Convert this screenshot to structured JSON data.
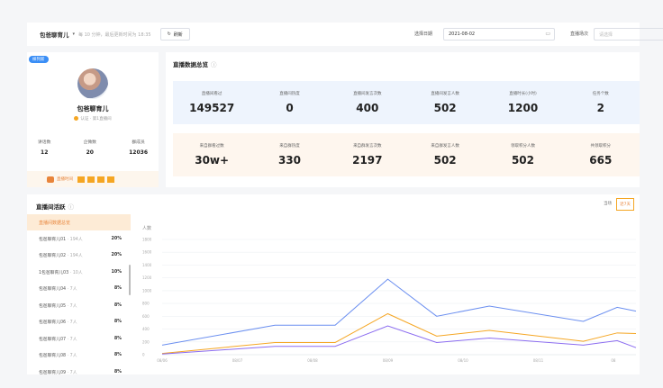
{
  "topbar": {
    "brand": "包爸聊育儿",
    "hint": "每 10 分钟，最后更新时间为 18:35",
    "refresh_label": "刷新",
    "date_label": "选择日期",
    "date_value": "2021-08-02",
    "scene_label": "直播场次",
    "scene_placeholder": "请选择"
  },
  "profile": {
    "tag": "样列新",
    "name": "包爸聊育儿",
    "meta": "认证 · 第1直播间",
    "stats": [
      {
        "label": "讲话数",
        "value": "12"
      },
      {
        "label": "企微数",
        "value": "20"
      },
      {
        "label": "群成员",
        "value": "12036"
      }
    ],
    "live_label": "直播时间"
  },
  "overview": {
    "title": "直播数据总览",
    "row1": [
      {
        "label": "直播间看过",
        "value": "149527"
      },
      {
        "label": "直播间热度",
        "value": "0"
      },
      {
        "label": "直播间发言次数",
        "value": "400"
      },
      {
        "label": "直播间发言人数",
        "value": "502"
      },
      {
        "label": "直播时长(小时)",
        "value": "1200"
      },
      {
        "label": "任务个数",
        "value": "2"
      }
    ],
    "row2": [
      {
        "label": "来自群看过数",
        "value": "30w+"
      },
      {
        "label": "来自群热度",
        "value": "330"
      },
      {
        "label": "来自群发言次数",
        "value": "2197"
      },
      {
        "label": "来自群发言人数",
        "value": "502"
      },
      {
        "label": "领取积分人数",
        "value": "502"
      },
      {
        "label": "共领取积分",
        "value": "665"
      }
    ]
  },
  "activity": {
    "title": "直播间活跃",
    "seg": [
      "当场",
      "近7天"
    ],
    "list_head": "直播间数据总览",
    "list": [
      {
        "name": "包爸聊育儿01",
        "sub": "· 194人",
        "pct": "20%"
      },
      {
        "name": "包爸聊育儿02",
        "sub": "· 194人",
        "pct": "20%"
      },
      {
        "name": "1包爸聊育儿03",
        "sub": "· 10人",
        "pct": "10%"
      },
      {
        "name": "包爸聊育儿04",
        "sub": "· 7人",
        "pct": "8%"
      },
      {
        "name": "包爸聊育儿05",
        "sub": "· 7人",
        "pct": "8%"
      },
      {
        "name": "包爸聊育儿06",
        "sub": "· 7人",
        "pct": "8%"
      },
      {
        "name": "包爸聊育儿07",
        "sub": "· 7人",
        "pct": "8%"
      },
      {
        "name": "包爸聊育儿08",
        "sub": "· 7人",
        "pct": "8%"
      },
      {
        "name": "包爸聊育儿09",
        "sub": "· 7人",
        "pct": "8%"
      }
    ]
  },
  "chart_data": {
    "type": "line",
    "ylabel": "人数",
    "ylim": [
      0,
      1800
    ],
    "yticks": [
      0,
      200,
      400,
      600,
      800,
      1000,
      1200,
      1400,
      1600,
      1800
    ],
    "x": [
      "08/06",
      "08/07",
      "08/08",
      "08/09",
      "08/10",
      "08/11",
      "08"
    ],
    "series": [
      {
        "color": "#6b8ff0",
        "x": [
          0,
          1.5,
          2.3,
          3,
          3.65,
          4.35,
          5.6,
          6.05,
          6.3
        ],
        "y": [
          150,
          460,
          460,
          1180,
          600,
          760,
          520,
          740,
          680
        ]
      },
      {
        "color": "#f5a623",
        "x": [
          0,
          1.5,
          2.3,
          3,
          3.65,
          4.35,
          5.6,
          6.05,
          6.3
        ],
        "y": [
          20,
          190,
          190,
          640,
          290,
          380,
          210,
          340,
          330
        ]
      },
      {
        "color": "#8b6cf0",
        "x": [
          0,
          1.5,
          2.3,
          3,
          3.65,
          4.35,
          5.6,
          6.05,
          6.3
        ],
        "y": [
          10,
          130,
          130,
          450,
          190,
          260,
          150,
          220,
          110
        ]
      }
    ]
  }
}
